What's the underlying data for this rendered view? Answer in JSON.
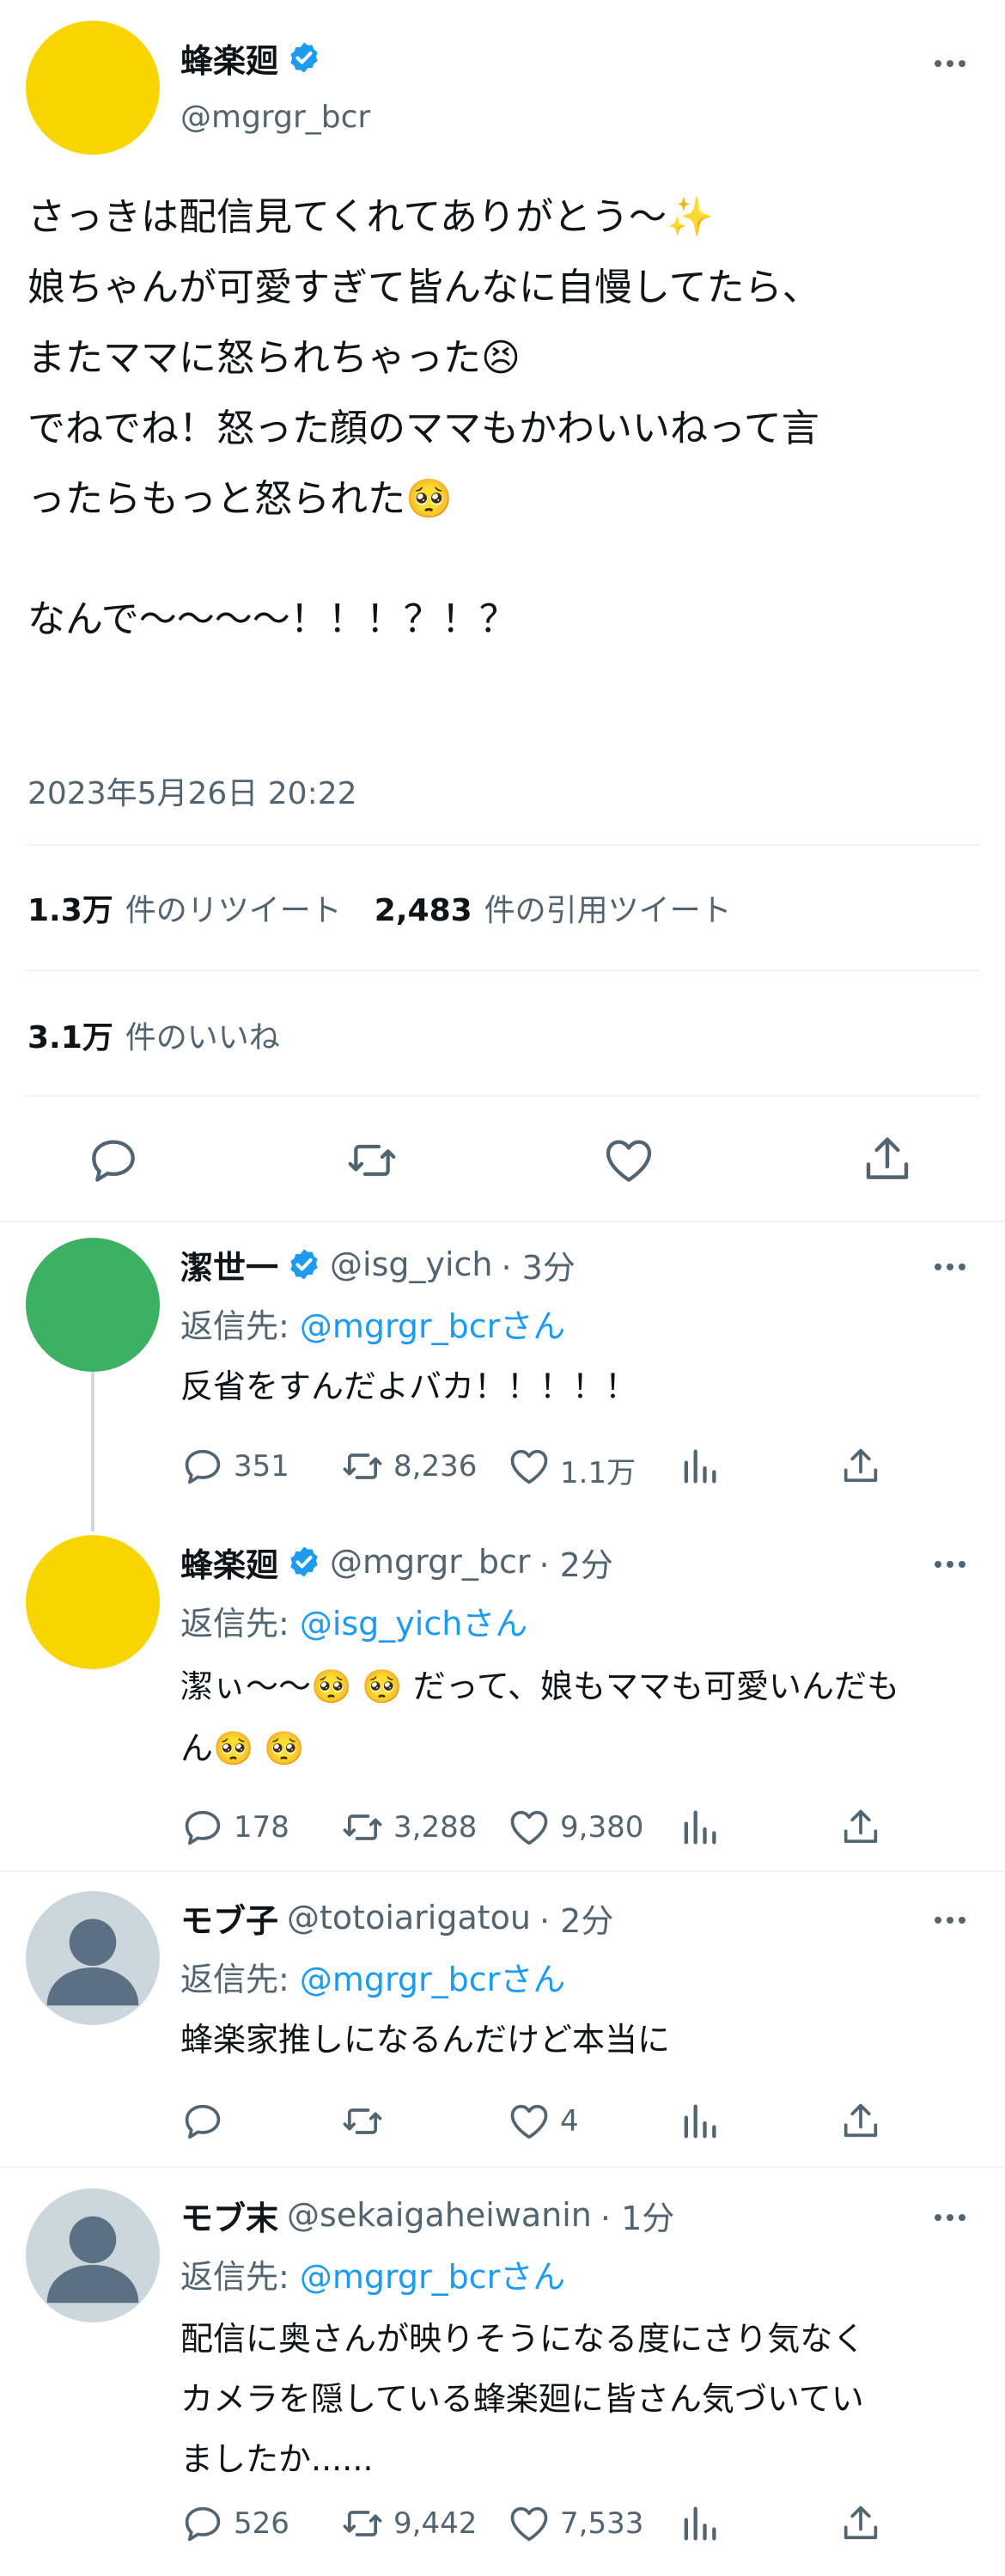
{
  "main_tweet": {
    "display_name": "蜂楽廻",
    "handle": "@mgrgr_bcr",
    "lines": [
      "さっきは配信見てくれてありがとう〜✨",
      "娘ちゃんが可愛すぎて皆んなに自慢してたら、",
      "またママに怒られちゃった😣",
      "でねでね！怒った顔のママもかわいいねって言",
      "ったらもっと怒られた🥺",
      "なんで〜〜〜〜！！！？！？"
    ],
    "timestamp": "2023年5月26日 20:22",
    "retweets_count": "1.3万",
    "retweets_label": "件のリツイート",
    "quotes_count": "2,483",
    "quotes_label": "件の引用ツイート",
    "likes_count": "3.1万",
    "likes_label": "件のいいね"
  },
  "replies": [
    {
      "name": "潔世一",
      "verified": true,
      "handle": "@isg_yich",
      "time": "· 3分",
      "reply_to_label": "返信先:",
      "reply_to_target": "@mgrgr_bcrさん",
      "text_lines": [
        "反省をすんだよバカ！！！！！"
      ],
      "reply_count": "351",
      "retweet_count": "8,236",
      "like_count": "1.1万",
      "avatar_color": "#3cb063"
    },
    {
      "name": "蜂楽廻",
      "verified": true,
      "handle": "@mgrgr_bcr",
      "time": "· 2分",
      "reply_to_label": "返信先:",
      "reply_to_target": "@isg_yichさん",
      "text_lines": [
        "潔ぃ〜〜🥺 🥺 だって、娘もママも可愛いんだも",
        "ん🥺 🥺"
      ],
      "reply_count": "178",
      "retweet_count": "3,288",
      "like_count": "9,380",
      "avatar_color": "#f9d500"
    },
    {
      "name": "モブ子",
      "verified": false,
      "handle": "@totoiarigatou",
      "time": "· 2分",
      "reply_to_label": "返信先:",
      "reply_to_target": "@mgrgr_bcrさん",
      "text_lines": [
        "蜂楽家推しになるんだけど本当に"
      ],
      "reply_count": "",
      "retweet_count": "",
      "like_count": "4",
      "avatar_color": "#ccd6dd"
    },
    {
      "name": "モブ末",
      "verified": false,
      "handle": "@sekaigaheiwanin",
      "time": "· 1分",
      "reply_to_label": "返信先:",
      "reply_to_target": "@mgrgr_bcrさん",
      "text_lines": [
        "配信に奥さんが映りそうになる度にさり気なく",
        "カメラを隠している蜂楽廻に皆さん気づいてい",
        "ましたか......"
      ],
      "reply_count": "526",
      "retweet_count": "9,442",
      "like_count": "7,533",
      "avatar_color": "#ccd6dd"
    }
  ],
  "colors": {
    "accent": "#1d9bf0",
    "muted": "#536471",
    "divider": "#eff3f4",
    "main_avatar": "#f9d500"
  }
}
